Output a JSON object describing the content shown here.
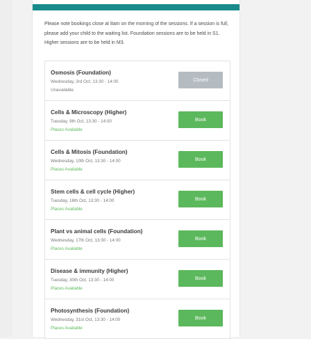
{
  "colors": {
    "accent": "#1a8b8b",
    "available": "#5cb85c",
    "book_button": "#5cb85c",
    "closed_button": "#b4bcc2"
  },
  "notice": "Please note bookings close at 8am on the morning of the sessions. If a session is full, please add your child to the waiting list. Foundation sessions are to be held in S1. Higher sessions are to be held in M3.",
  "sessions": [
    {
      "title": "Osmosis (Foundation)",
      "date": "Wednesday, 3rd Oct, 13:30 - 14:00",
      "status": "Unavailable",
      "available": false,
      "button": "Closed"
    },
    {
      "title": "Cells & Microscopy (Higher)",
      "date": "Tuesday, 9th Oct, 13:30 - 14:00",
      "status": "Places Available",
      "available": true,
      "button": "Book"
    },
    {
      "title": "Cells & Mitosis (Foundation)",
      "date": "Wednesday, 10th Oct, 13:30 - 14:00",
      "status": "Places Available",
      "available": true,
      "button": "Book"
    },
    {
      "title": "Stem cells & cell cycle (Higher)",
      "date": "Tuesday, 16th Oct, 13:30 - 14:00",
      "status": "Places Available",
      "available": true,
      "button": "Book"
    },
    {
      "title": "Plant vs animal cells (Foundation)",
      "date": "Wednesday, 17th Oct, 13:30 - 14:00",
      "status": "Places Available",
      "available": true,
      "button": "Book"
    },
    {
      "title": "Disease & immunity (Higher)",
      "date": "Tuesday, 30th Oct, 13:30 - 14:00",
      "status": "Places Available",
      "available": true,
      "button": "Book"
    },
    {
      "title": "Photosynthesis (Foundation)",
      "date": "Wednesday, 31st Oct, 13:30 - 14:00",
      "status": "Places Available",
      "available": true,
      "button": "Book"
    }
  ]
}
